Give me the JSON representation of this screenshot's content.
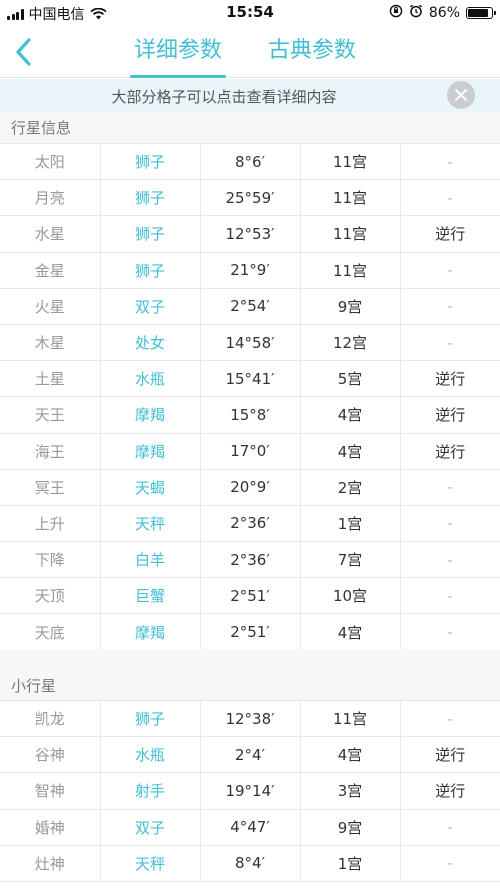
{
  "status_bar": {
    "carrier": "中国电信",
    "time": "15:54",
    "battery_percent": "86%",
    "battery_level": 0.86
  },
  "nav": {
    "tabs": [
      {
        "label": "详细参数",
        "active": true
      },
      {
        "label": "古典参数",
        "active": false
      }
    ]
  },
  "notice": {
    "text": "大部分格子可以点击查看详细内容"
  },
  "sections": [
    {
      "title": "行星信息",
      "rows": [
        {
          "name": "太阳",
          "sign": "狮子",
          "degree": "8°6′",
          "house": "11宫",
          "retro": "-"
        },
        {
          "name": "月亮",
          "sign": "狮子",
          "degree": "25°59′",
          "house": "11宫",
          "retro": "-"
        },
        {
          "name": "水星",
          "sign": "狮子",
          "degree": "12°53′",
          "house": "11宫",
          "retro": "逆行"
        },
        {
          "name": "金星",
          "sign": "狮子",
          "degree": "21°9′",
          "house": "11宫",
          "retro": "-"
        },
        {
          "name": "火星",
          "sign": "双子",
          "degree": "2°54′",
          "house": "9宫",
          "retro": "-"
        },
        {
          "name": "木星",
          "sign": "处女",
          "degree": "14°58′",
          "house": "12宫",
          "retro": "-"
        },
        {
          "name": "土星",
          "sign": "水瓶",
          "degree": "15°41′",
          "house": "5宫",
          "retro": "逆行"
        },
        {
          "name": "天王",
          "sign": "摩羯",
          "degree": "15°8′",
          "house": "4宫",
          "retro": "逆行"
        },
        {
          "name": "海王",
          "sign": "摩羯",
          "degree": "17°0′",
          "house": "4宫",
          "retro": "逆行"
        },
        {
          "name": "冥王",
          "sign": "天蝎",
          "degree": "20°9′",
          "house": "2宫",
          "retro": "-"
        },
        {
          "name": "上升",
          "sign": "天秤",
          "degree": "2°36′",
          "house": "1宫",
          "retro": "-"
        },
        {
          "name": "下降",
          "sign": "白羊",
          "degree": "2°36′",
          "house": "7宫",
          "retro": "-"
        },
        {
          "name": "天顶",
          "sign": "巨蟹",
          "degree": "2°51′",
          "house": "10宫",
          "retro": "-"
        },
        {
          "name": "天底",
          "sign": "摩羯",
          "degree": "2°51′",
          "house": "4宫",
          "retro": "-"
        }
      ]
    },
    {
      "title": "小行星",
      "rows": [
        {
          "name": "凯龙",
          "sign": "狮子",
          "degree": "12°38′",
          "house": "11宫",
          "retro": "-"
        },
        {
          "name": "谷神",
          "sign": "水瓶",
          "degree": "2°4′",
          "house": "4宫",
          "retro": "逆行"
        },
        {
          "name": "智神",
          "sign": "射手",
          "degree": "19°14′",
          "house": "3宫",
          "retro": "逆行"
        },
        {
          "name": "婚神",
          "sign": "双子",
          "degree": "4°47′",
          "house": "9宫",
          "retro": "-"
        },
        {
          "name": "灶神",
          "sign": "天秤",
          "degree": "8°4′",
          "house": "1宫",
          "retro": "-"
        }
      ]
    }
  ]
}
